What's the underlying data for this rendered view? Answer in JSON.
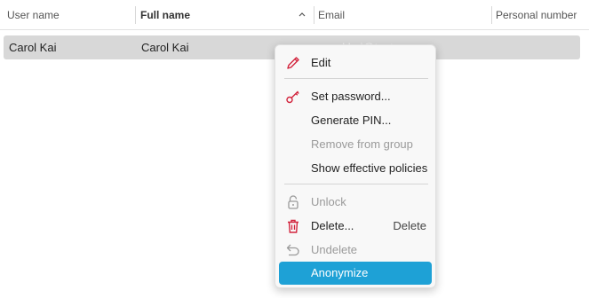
{
  "columns": [
    {
      "label": "User name"
    },
    {
      "label": "Full name"
    },
    {
      "label": "Email"
    },
    {
      "label": "Personal number"
    }
  ],
  "row": {
    "user_name": "Carol Kai",
    "full_name": "Carol Kai",
    "email": "carol.kai@test.com"
  },
  "menu": {
    "edit": "Edit",
    "set_password": "Set password...",
    "generate_pin": "Generate PIN...",
    "remove_from_group": "Remove from group",
    "show_policies": "Show effective policies",
    "unlock": "Unlock",
    "delete": "Delete...",
    "delete_shortcut": "Delete",
    "undelete": "Undelete",
    "anonymize": "Anonymize"
  },
  "colors": {
    "accent": "#1ea1d6",
    "icon_red": "#d2233c",
    "disabled_icon": "#9a9a9a"
  },
  "icons": {
    "edit": "pencil-icon",
    "set_password": "key-icon",
    "unlock": "padlock-icon",
    "delete": "trash-icon",
    "undelete": "undo-arrow-icon",
    "sort": "chevron-up-icon"
  }
}
